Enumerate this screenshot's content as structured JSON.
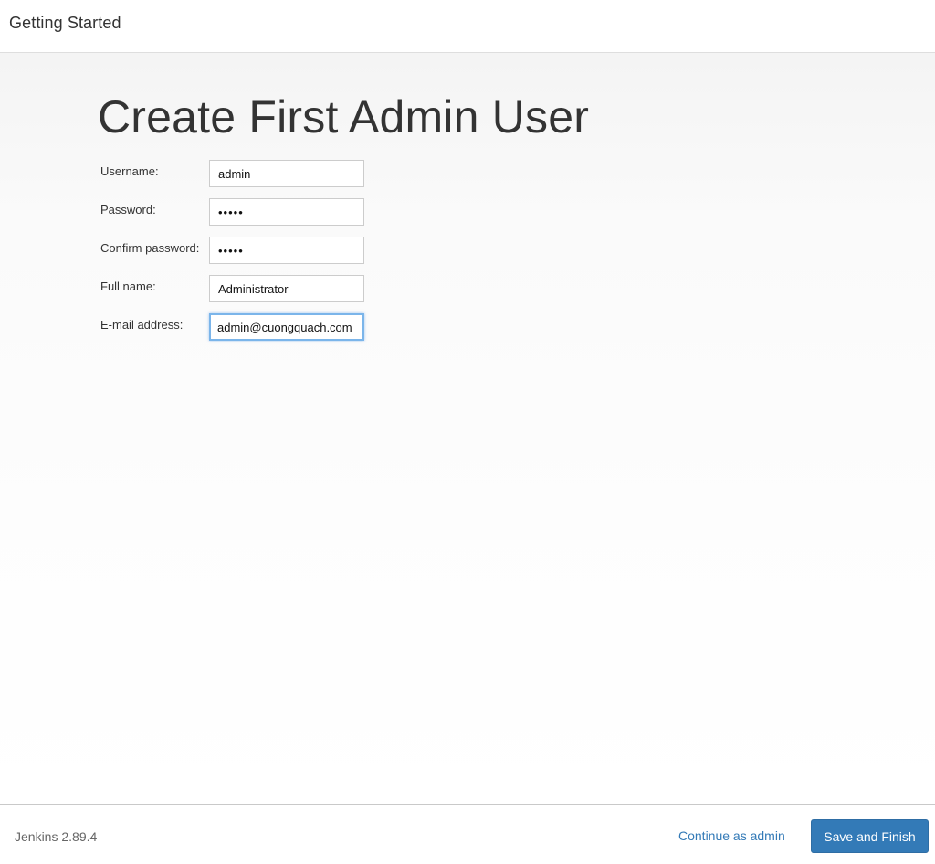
{
  "header": {
    "title": "Getting Started"
  },
  "main": {
    "title": "Create First Admin User",
    "fields": [
      {
        "label": "Username:",
        "value": "admin"
      },
      {
        "label": "Password:",
        "value": "•••••"
      },
      {
        "label": "Confirm password:",
        "value": "•••••"
      },
      {
        "label": "Full name:",
        "value": "Administrator"
      },
      {
        "label": "E-mail address:",
        "value": "admin@cuongquach.com"
      }
    ]
  },
  "footer": {
    "version": "Jenkins 2.89.4",
    "continue_label": "Continue as admin",
    "save_label": "Save and Finish"
  },
  "colors": {
    "accent": "#337ab7",
    "focus_ring": "#7bb5ea",
    "spellcheck": "#e04a4a"
  }
}
